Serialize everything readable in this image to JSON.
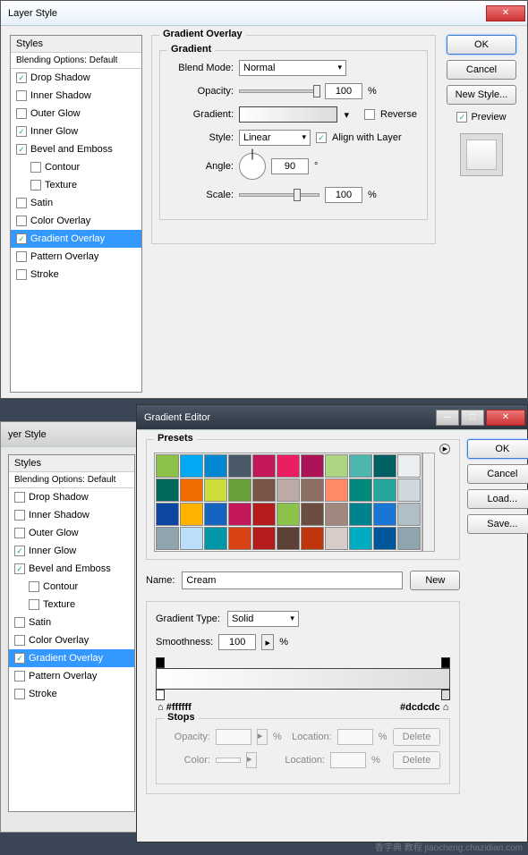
{
  "win1": {
    "title": "Layer Style",
    "styles_header": "Styles",
    "blending": "Blending Options: Default",
    "items": [
      {
        "label": "Drop Shadow",
        "checked": true
      },
      {
        "label": "Inner Shadow",
        "checked": false
      },
      {
        "label": "Outer Glow",
        "checked": false
      },
      {
        "label": "Inner Glow",
        "checked": true
      },
      {
        "label": "Bevel and Emboss",
        "checked": true
      },
      {
        "label": "Contour",
        "checked": false,
        "sub": true
      },
      {
        "label": "Texture",
        "checked": false,
        "sub": true
      },
      {
        "label": "Satin",
        "checked": false
      },
      {
        "label": "Color Overlay",
        "checked": false
      },
      {
        "label": "Gradient Overlay",
        "checked": true,
        "sel": true
      },
      {
        "label": "Pattern Overlay",
        "checked": false
      },
      {
        "label": "Stroke",
        "checked": false
      }
    ],
    "section": "Gradient Overlay",
    "gradient_legend": "Gradient",
    "blend_mode_label": "Blend Mode:",
    "blend_mode": "Normal",
    "opacity_label": "Opacity:",
    "opacity": "100",
    "pct": "%",
    "gradient_label": "Gradient:",
    "reverse": "Reverse",
    "style_label": "Style:",
    "style": "Linear",
    "align": "Align with Layer",
    "angle_label": "Angle:",
    "angle": "90",
    "deg": "°",
    "scale_label": "Scale:",
    "scale": "100",
    "ok": "OK",
    "cancel": "Cancel",
    "new_style": "New Style...",
    "preview": "Preview"
  },
  "win2": {
    "title": "yer Style",
    "styles_header": "Styles",
    "blending": "Blending Options: Default",
    "items": [
      {
        "label": "Drop Shadow",
        "checked": false
      },
      {
        "label": "Inner Shadow",
        "checked": false
      },
      {
        "label": "Outer Glow",
        "checked": false
      },
      {
        "label": "Inner Glow",
        "checked": true
      },
      {
        "label": "Bevel and Emboss",
        "checked": true
      },
      {
        "label": "Contour",
        "checked": false,
        "sub": true
      },
      {
        "label": "Texture",
        "checked": false,
        "sub": true
      },
      {
        "label": "Satin",
        "checked": false
      },
      {
        "label": "Color Overlay",
        "checked": false
      },
      {
        "label": "Gradient Overlay",
        "checked": true,
        "sel": true
      },
      {
        "label": "Pattern Overlay",
        "checked": false
      },
      {
        "label": "Stroke",
        "checked": false
      }
    ]
  },
  "ge": {
    "title": "Gradient Editor",
    "presets": "Presets",
    "name_label": "Name:",
    "name": "Cream",
    "new": "New",
    "type_label": "Gradient Type:",
    "type": "Solid",
    "smooth_label": "Smoothness:",
    "smooth": "100",
    "pct": "%",
    "hex_left": "#ffffff",
    "hex_right": "#dcdcdc",
    "stops": "Stops",
    "opacity_label": "Opacity:",
    "location_label": "Location:",
    "color_label": "Color:",
    "delete": "Delete",
    "ok": "OK",
    "cancel": "Cancel",
    "load": "Load...",
    "save": "Save..."
  },
  "preset_colors": [
    "#8bc34a",
    "#03a9f4",
    "#0288d1",
    "#4a5a6a",
    "#c2185b",
    "#e91e63",
    "#ad1457",
    "#aed581",
    "#4db6ac",
    "#006064",
    "#eceff1",
    "#00695c",
    "#ef6c00",
    "#cddc39",
    "#689f38",
    "#795548",
    "#bcaaa4",
    "#8d6e63",
    "#ff8a65",
    "#00897b",
    "#26a69a",
    "#cfd8dc",
    "#0d47a1",
    "#ffb300",
    "#1565c0",
    "#c2185b",
    "#b71c1c",
    "#8bc34a",
    "#6d4c41",
    "#a1887f",
    "#00838f",
    "#1976d2",
    "#b0bec5",
    "#90a4ae",
    "#bbdefb",
    "#0097a7",
    "#d84315",
    "#b71c1c",
    "#5d4037",
    "#bf360c",
    "#d7ccc8",
    "#00acc1",
    "#01579b",
    "#90a4ae"
  ],
  "watermark": "香字典 教程 jiaocheng.chazidian.com"
}
